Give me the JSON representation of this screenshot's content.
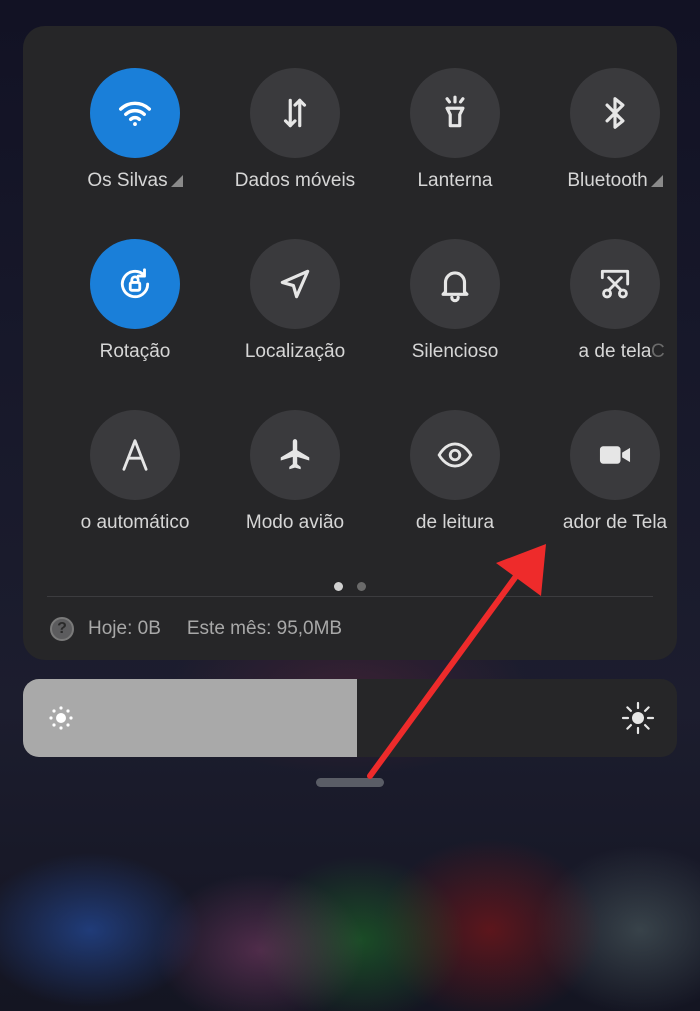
{
  "tiles": [
    {
      "label": "Os Silvas",
      "icon": "wifi-icon",
      "active": true,
      "caret": true
    },
    {
      "label": "Dados móveis",
      "icon": "mobile-data-icon",
      "active": false,
      "caret": false
    },
    {
      "label": "Lanterna",
      "icon": "flashlight-icon",
      "active": false,
      "caret": false
    },
    {
      "label": "Bluetooth",
      "icon": "bluetooth-icon",
      "active": false,
      "caret": true
    },
    {
      "label": "Rotação",
      "icon": "rotation-lock-icon",
      "active": true,
      "caret": false
    },
    {
      "label": "Localização",
      "icon": "location-icon",
      "active": false,
      "caret": false
    },
    {
      "label": "Silencioso",
      "icon": "bell-icon",
      "active": false,
      "caret": false
    },
    {
      "label": "a de tela",
      "icon": "screenshot-scissors-icon",
      "active": false,
      "caret": false
    },
    {
      "label": "o automático",
      "icon": "auto-brightness-a-icon",
      "active": false,
      "caret": false
    },
    {
      "label": "Modo avião",
      "icon": "airplane-icon",
      "active": false,
      "caret": false
    },
    {
      "label": "de leitura",
      "icon": "eye-icon",
      "active": false,
      "caret": false
    },
    {
      "label": "ador de Tela",
      "icon": "video-camera-icon",
      "active": false,
      "caret": false
    }
  ],
  "stray_label": "C",
  "pagination": {
    "pages": 2,
    "current": 1
  },
  "usage": {
    "today": "Hoje: 0B",
    "month": "Este mês: 95,0MB",
    "icon": "help-icon"
  },
  "brightness": {
    "level": 0.51,
    "low_icon": "brightness-low-icon",
    "high_icon": "brightness-high-icon"
  },
  "colors": {
    "active": "#1a7fd9",
    "annotation_arrow": "#ee2b2b"
  }
}
